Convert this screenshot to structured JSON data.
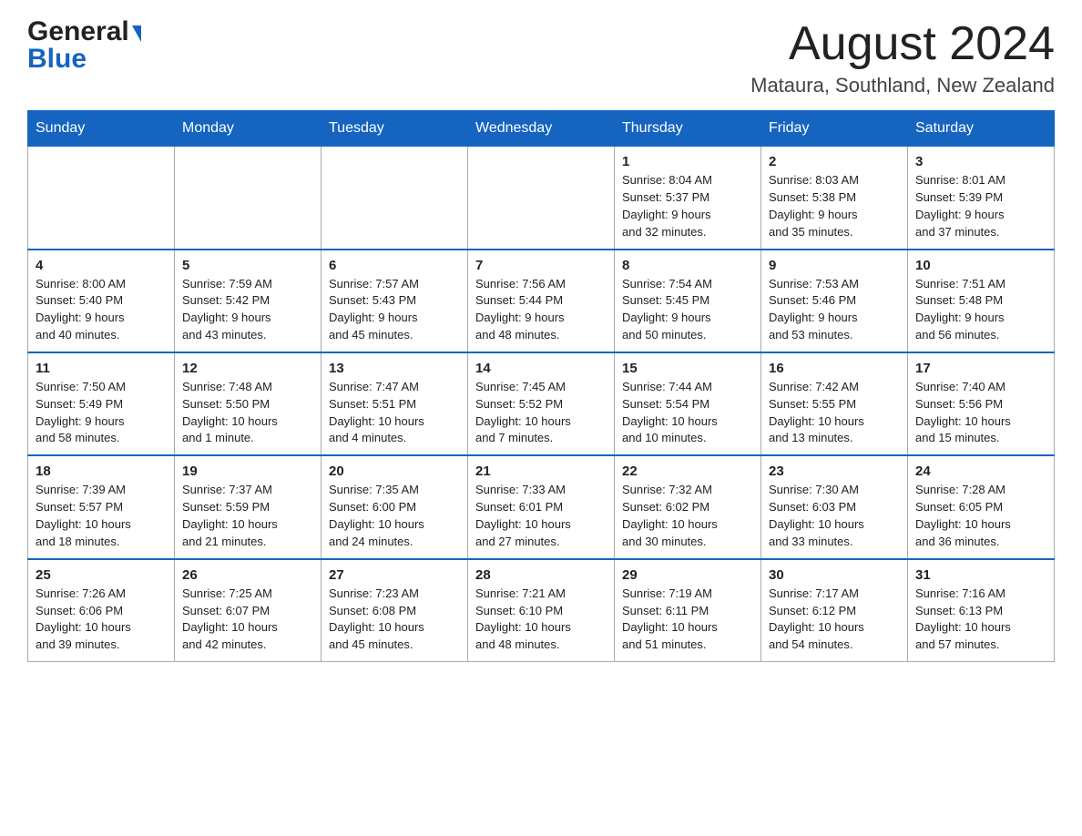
{
  "header": {
    "logo_line1": "General",
    "logo_line2": "Blue",
    "month_title": "August 2024",
    "location": "Mataura, Southland, New Zealand"
  },
  "days_of_week": [
    "Sunday",
    "Monday",
    "Tuesday",
    "Wednesday",
    "Thursday",
    "Friday",
    "Saturday"
  ],
  "weeks": [
    [
      {
        "day": "",
        "info": ""
      },
      {
        "day": "",
        "info": ""
      },
      {
        "day": "",
        "info": ""
      },
      {
        "day": "",
        "info": ""
      },
      {
        "day": "1",
        "info": "Sunrise: 8:04 AM\nSunset: 5:37 PM\nDaylight: 9 hours\nand 32 minutes."
      },
      {
        "day": "2",
        "info": "Sunrise: 8:03 AM\nSunset: 5:38 PM\nDaylight: 9 hours\nand 35 minutes."
      },
      {
        "day": "3",
        "info": "Sunrise: 8:01 AM\nSunset: 5:39 PM\nDaylight: 9 hours\nand 37 minutes."
      }
    ],
    [
      {
        "day": "4",
        "info": "Sunrise: 8:00 AM\nSunset: 5:40 PM\nDaylight: 9 hours\nand 40 minutes."
      },
      {
        "day": "5",
        "info": "Sunrise: 7:59 AM\nSunset: 5:42 PM\nDaylight: 9 hours\nand 43 minutes."
      },
      {
        "day": "6",
        "info": "Sunrise: 7:57 AM\nSunset: 5:43 PM\nDaylight: 9 hours\nand 45 minutes."
      },
      {
        "day": "7",
        "info": "Sunrise: 7:56 AM\nSunset: 5:44 PM\nDaylight: 9 hours\nand 48 minutes."
      },
      {
        "day": "8",
        "info": "Sunrise: 7:54 AM\nSunset: 5:45 PM\nDaylight: 9 hours\nand 50 minutes."
      },
      {
        "day": "9",
        "info": "Sunrise: 7:53 AM\nSunset: 5:46 PM\nDaylight: 9 hours\nand 53 minutes."
      },
      {
        "day": "10",
        "info": "Sunrise: 7:51 AM\nSunset: 5:48 PM\nDaylight: 9 hours\nand 56 minutes."
      }
    ],
    [
      {
        "day": "11",
        "info": "Sunrise: 7:50 AM\nSunset: 5:49 PM\nDaylight: 9 hours\nand 58 minutes."
      },
      {
        "day": "12",
        "info": "Sunrise: 7:48 AM\nSunset: 5:50 PM\nDaylight: 10 hours\nand 1 minute."
      },
      {
        "day": "13",
        "info": "Sunrise: 7:47 AM\nSunset: 5:51 PM\nDaylight: 10 hours\nand 4 minutes."
      },
      {
        "day": "14",
        "info": "Sunrise: 7:45 AM\nSunset: 5:52 PM\nDaylight: 10 hours\nand 7 minutes."
      },
      {
        "day": "15",
        "info": "Sunrise: 7:44 AM\nSunset: 5:54 PM\nDaylight: 10 hours\nand 10 minutes."
      },
      {
        "day": "16",
        "info": "Sunrise: 7:42 AM\nSunset: 5:55 PM\nDaylight: 10 hours\nand 13 minutes."
      },
      {
        "day": "17",
        "info": "Sunrise: 7:40 AM\nSunset: 5:56 PM\nDaylight: 10 hours\nand 15 minutes."
      }
    ],
    [
      {
        "day": "18",
        "info": "Sunrise: 7:39 AM\nSunset: 5:57 PM\nDaylight: 10 hours\nand 18 minutes."
      },
      {
        "day": "19",
        "info": "Sunrise: 7:37 AM\nSunset: 5:59 PM\nDaylight: 10 hours\nand 21 minutes."
      },
      {
        "day": "20",
        "info": "Sunrise: 7:35 AM\nSunset: 6:00 PM\nDaylight: 10 hours\nand 24 minutes."
      },
      {
        "day": "21",
        "info": "Sunrise: 7:33 AM\nSunset: 6:01 PM\nDaylight: 10 hours\nand 27 minutes."
      },
      {
        "day": "22",
        "info": "Sunrise: 7:32 AM\nSunset: 6:02 PM\nDaylight: 10 hours\nand 30 minutes."
      },
      {
        "day": "23",
        "info": "Sunrise: 7:30 AM\nSunset: 6:03 PM\nDaylight: 10 hours\nand 33 minutes."
      },
      {
        "day": "24",
        "info": "Sunrise: 7:28 AM\nSunset: 6:05 PM\nDaylight: 10 hours\nand 36 minutes."
      }
    ],
    [
      {
        "day": "25",
        "info": "Sunrise: 7:26 AM\nSunset: 6:06 PM\nDaylight: 10 hours\nand 39 minutes."
      },
      {
        "day": "26",
        "info": "Sunrise: 7:25 AM\nSunset: 6:07 PM\nDaylight: 10 hours\nand 42 minutes."
      },
      {
        "day": "27",
        "info": "Sunrise: 7:23 AM\nSunset: 6:08 PM\nDaylight: 10 hours\nand 45 minutes."
      },
      {
        "day": "28",
        "info": "Sunrise: 7:21 AM\nSunset: 6:10 PM\nDaylight: 10 hours\nand 48 minutes."
      },
      {
        "day": "29",
        "info": "Sunrise: 7:19 AM\nSunset: 6:11 PM\nDaylight: 10 hours\nand 51 minutes."
      },
      {
        "day": "30",
        "info": "Sunrise: 7:17 AM\nSunset: 6:12 PM\nDaylight: 10 hours\nand 54 minutes."
      },
      {
        "day": "31",
        "info": "Sunrise: 7:16 AM\nSunset: 6:13 PM\nDaylight: 10 hours\nand 57 minutes."
      }
    ]
  ]
}
